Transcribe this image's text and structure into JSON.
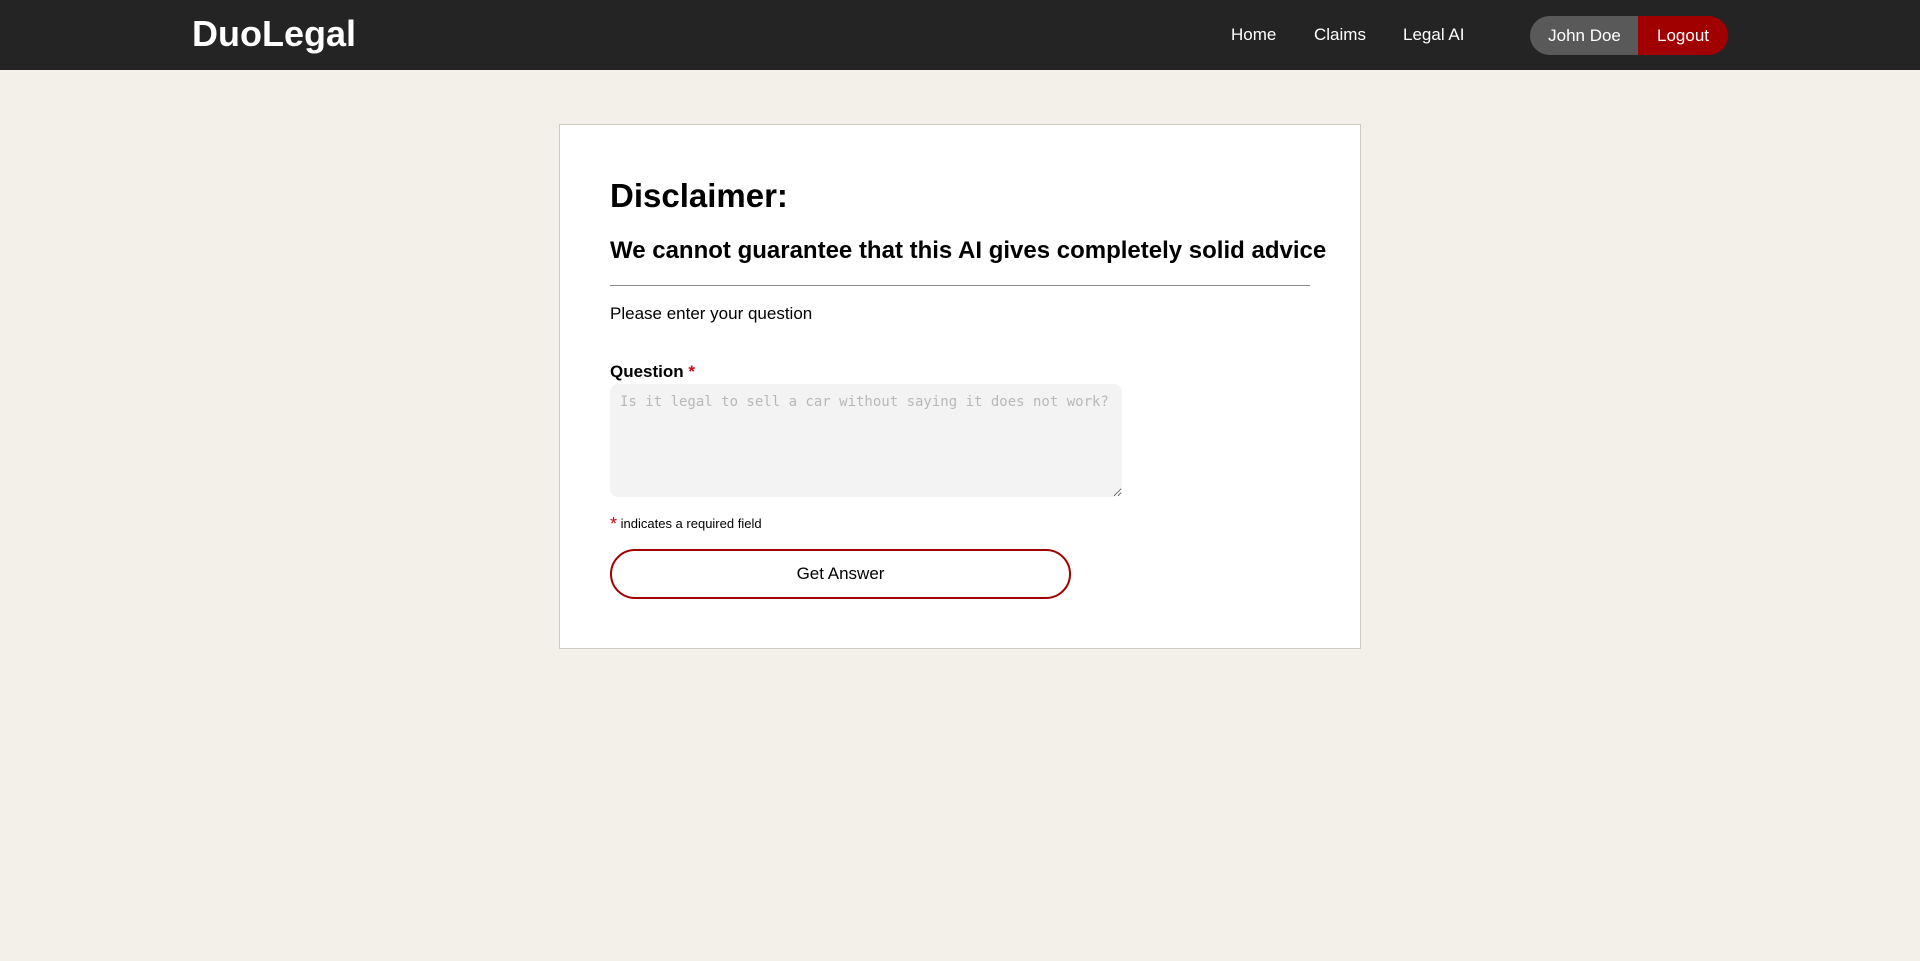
{
  "navbar": {
    "brand": "DuoLegal",
    "links": [
      "Home",
      "Claims",
      "Legal AI"
    ],
    "user_name": "John Doe",
    "logout_label": "Logout"
  },
  "main": {
    "disclaimer_title": "Disclaimer:",
    "disclaimer_subtitle": "We cannot guarantee that this AI gives completely solid advice",
    "prompt": "Please enter your question",
    "question_label": "Question",
    "required_marker": "*",
    "question_placeholder": "Is it legal to sell a car without saying it does not work?",
    "required_note": "indicates a required field",
    "submit_label": "Get Answer"
  },
  "colors": {
    "navbar_bg": "#242424",
    "page_bg": "#f3f0e9",
    "accent_red": "#a00000",
    "user_pill": "#595959",
    "required_star": "#d0021b"
  }
}
